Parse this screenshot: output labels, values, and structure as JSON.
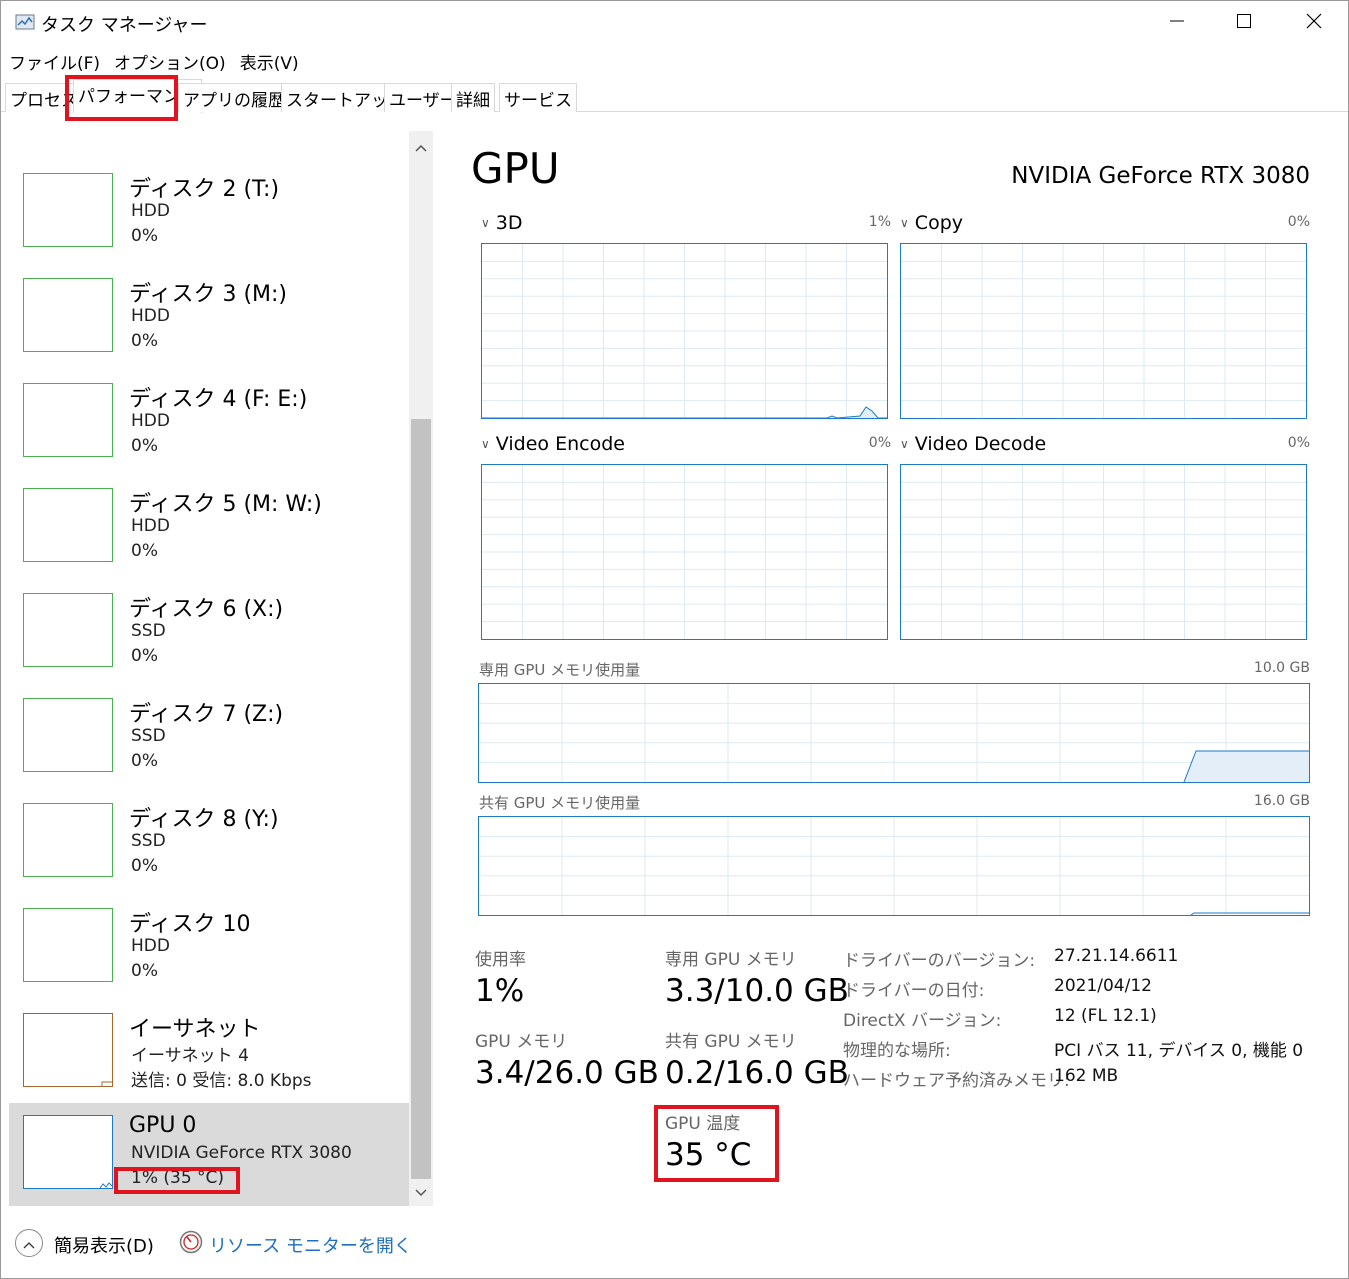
{
  "window": {
    "title": "タスク マネージャー",
    "icons": {
      "app": "task-manager-icon",
      "minimize": "minimize-icon",
      "maximize": "maximize-icon",
      "close": "close-icon"
    }
  },
  "menu": [
    "ファイル(F)",
    "オプション(O)",
    "表示(V)"
  ],
  "tabs": [
    "プロセス",
    "パフォーマンス",
    "アプリの履歴",
    "スタートアップ",
    "ユーザー",
    "詳細",
    "サービス"
  ],
  "active_tab": "パフォーマンス",
  "sidebar": {
    "partial_top_value": "0%",
    "items": [
      {
        "title": "ディスク 2 (T:)",
        "sub": "HDD",
        "value": "0%"
      },
      {
        "title": "ディスク 3 (M:)",
        "sub": "HDD",
        "value": "0%"
      },
      {
        "title": "ディスク 4 (F: E:)",
        "sub": "HDD",
        "value": "0%"
      },
      {
        "title": "ディスク 5 (M: W:)",
        "sub": "HDD",
        "value": "0%"
      },
      {
        "title": "ディスク 6 (X:)",
        "sub": "SSD",
        "value": "0%"
      },
      {
        "title": "ディスク 7 (Z:)",
        "sub": "SSD",
        "value": "0%"
      },
      {
        "title": "ディスク 8 (Y:)",
        "sub": "SSD",
        "value": "0%"
      },
      {
        "title": "ディスク 10",
        "sub": "HDD",
        "value": "0%"
      },
      {
        "title": "イーサネット",
        "sub": "イーサネット 4",
        "value": "送信: 0  受信: 8.0 Kbps"
      },
      {
        "title": "GPU 0",
        "sub": "NVIDIA GeForce RTX 3080",
        "value": "1%  (35 °C)"
      }
    ]
  },
  "gpu": {
    "title": "GPU",
    "model": "NVIDIA GeForce RTX 3080",
    "engines": [
      {
        "name": "3D",
        "percent": "1%"
      },
      {
        "name": "Copy",
        "percent": "0%"
      },
      {
        "name": "Video Encode",
        "percent": "0%"
      },
      {
        "name": "Video Decode",
        "percent": "0%"
      }
    ],
    "dedicated_mem_graph": {
      "label": "専用 GPU メモリ使用量",
      "max": "10.0 GB"
    },
    "shared_mem_graph": {
      "label": "共有 GPU メモリ使用量",
      "max": "16.0 GB"
    },
    "stats": {
      "usage_label": "使用率",
      "usage_value": "1%",
      "gpu_mem_label": "GPU メモリ",
      "gpu_mem_value": "3.4/26.0 GB",
      "dedicated_label": "専用 GPU メモリ",
      "dedicated_value": "3.3/10.0 GB",
      "shared_label": "共有 GPU メモリ",
      "shared_value": "0.2/16.0 GB",
      "temp_label": "GPU 温度",
      "temp_value": "35 °C"
    },
    "info": [
      {
        "label": "ドライバーのバージョン:",
        "value": "27.21.14.6611"
      },
      {
        "label": "ドライバーの日付:",
        "value": "2021/04/12"
      },
      {
        "label": "DirectX バージョン:",
        "value": "12 (FL 12.1)"
      },
      {
        "label": "物理的な場所:",
        "value": "PCI バス 11, デバイス 0, 機能 0"
      },
      {
        "label": "ハードウェア予約済みメモリ:",
        "value": "162 MB"
      }
    ]
  },
  "footer": {
    "fewer_details": "簡易表示(D)",
    "resource_monitor": "リソース モニターを開く"
  },
  "colors": {
    "graph_border": "#1e7ac4",
    "disk_border": "#4caf50",
    "ethernet_border": "#a8652d",
    "highlight": "#e0141e",
    "link": "#1e6fbf"
  }
}
